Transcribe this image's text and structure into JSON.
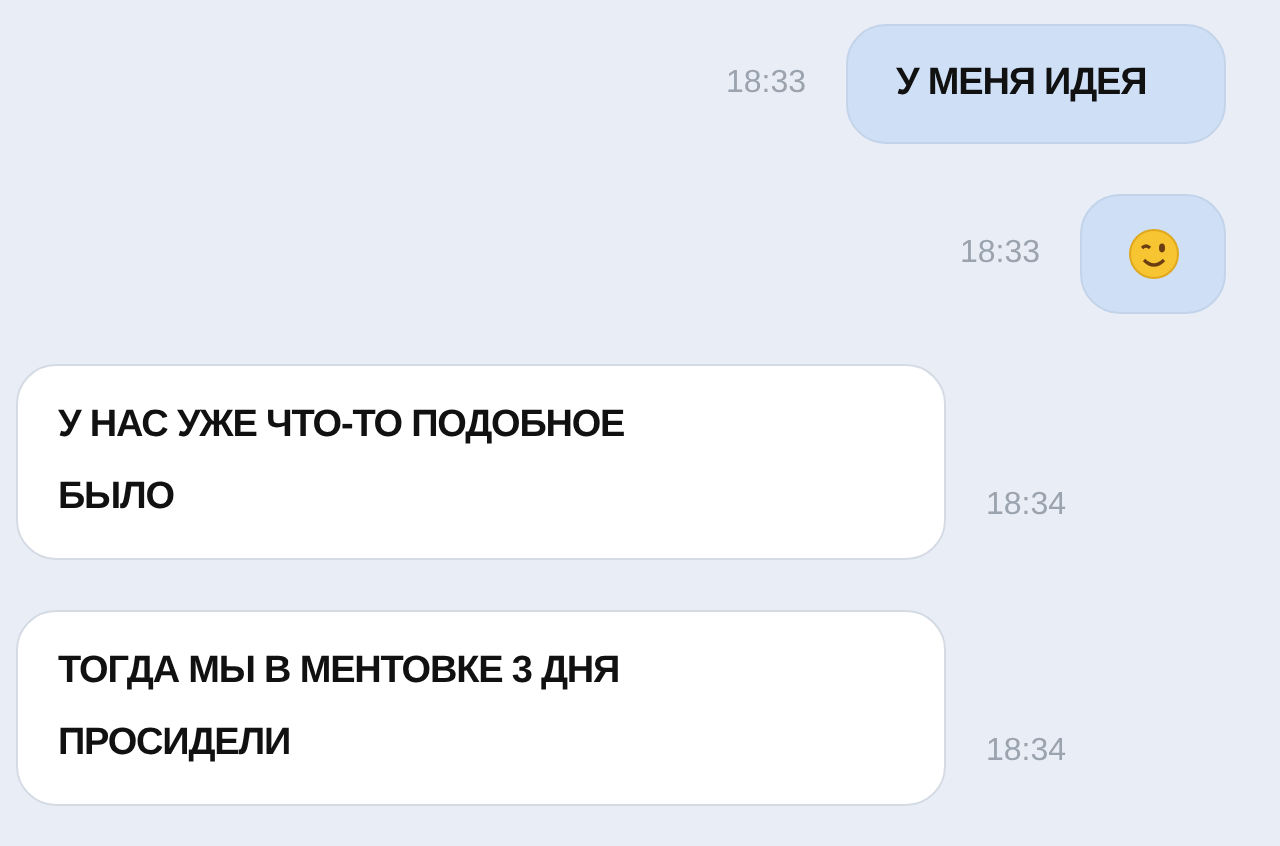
{
  "messages": [
    {
      "kind": "text",
      "outgoing": true,
      "lines": [
        "У МЕНЯ ИДЕЯ"
      ],
      "time": "18:33"
    },
    {
      "kind": "emoji",
      "outgoing": true,
      "time": "18:33"
    },
    {
      "kind": "text",
      "outgoing": false,
      "lines": [
        "У НАС УЖЕ ЧТО-ТО ПОДОБНОЕ",
        "БЫЛО"
      ],
      "time": "18:34"
    },
    {
      "kind": "text",
      "outgoing": false,
      "lines": [
        "ТОГДА МЫ В МЕНТОВКЕ 3 ДНЯ",
        "ПРОСИДЕЛИ"
      ],
      "time": "18:34"
    }
  ]
}
